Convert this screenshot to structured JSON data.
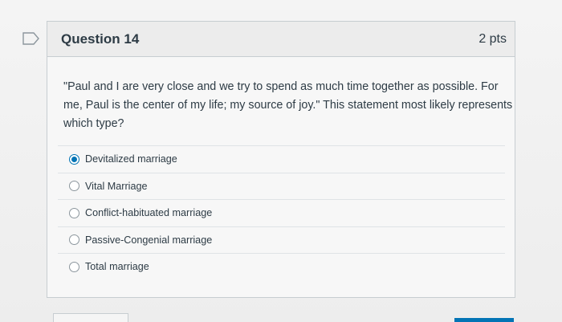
{
  "question": {
    "title": "Question 14",
    "points": "2 pts",
    "text": "\"Paul and I are very close and we try to spend as much time together as possible. For me, Paul is the center of my life; my source of joy.\" This statement most likely represents which type?"
  },
  "answers": [
    {
      "label": "Devitalized marriage",
      "selected": true
    },
    {
      "label": "Vital Marriage",
      "selected": false
    },
    {
      "label": "Conflict-habituated marriage",
      "selected": false
    },
    {
      "label": "Passive-Congenial marriage",
      "selected": false
    },
    {
      "label": "Total marriage",
      "selected": false
    }
  ],
  "icons": {
    "flag": "flag-icon"
  },
  "colors": {
    "accent": "#0374b5",
    "text": "#2d3b45",
    "border": "#c7cdd1"
  }
}
